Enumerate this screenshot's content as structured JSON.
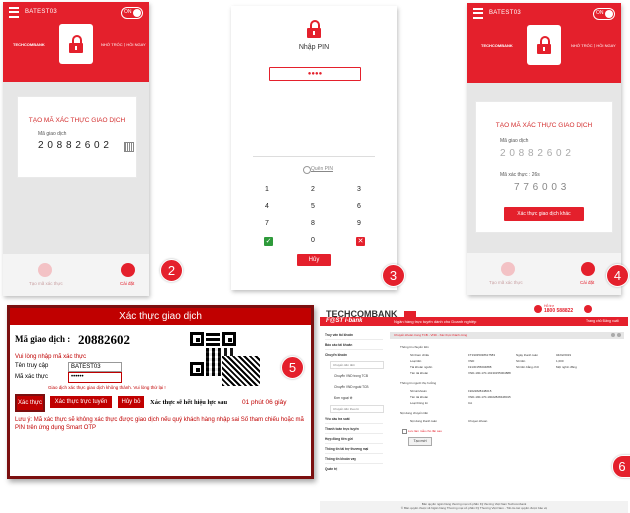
{
  "colors": {
    "brand_red": "#e4202c",
    "dark_red": "#c00000",
    "maroon": "#7b0f0f",
    "green": "#2e9a3a",
    "grey_text": "#9a9a9a"
  },
  "phone2": {
    "username": "BATEST03",
    "toggle": "ON",
    "brand": "TECHCOMBANK",
    "tagline": "NHỚ TRÓC ⟩ HỒI NGAY",
    "card_title": "TẠO MÃ XÁC THỰC GIAO DỊCH",
    "code_label": "Mã giao dịch",
    "code": "2 0 8 8 2 6 0 2",
    "nav_left": "Tạo mã xác thực",
    "nav_right": "Cài đặt",
    "badge": "2"
  },
  "phone3": {
    "title": "Nhập PIN",
    "pin_value": "●●●●",
    "forgot": "Quên PIN",
    "keys": [
      "1",
      "2",
      "3",
      "4",
      "5",
      "6",
      "7",
      "8",
      "9",
      "0"
    ],
    "cancel": "Hủy",
    "badge": "3"
  },
  "phone4": {
    "username": "BATEST03",
    "toggle": "ON",
    "brand": "TECHCOMBANK",
    "tagline": "NHỚ TRÓC ⟩ HỒI NGAY",
    "card_title": "TẠO MÃ XÁC THỰC GIAO DỊCH",
    "code_label": "Mã giao dịch",
    "code": "2 0 8 8 2 6 0 2",
    "auth_label": "Mã xác thực : 26s",
    "auth_code": "7 7 6 0 0 3",
    "other_button": "Xác thực giao dịch khác",
    "nav_left": "Tạo mã xác thực",
    "nav_right": "Cài đặt",
    "badge": "4"
  },
  "panel5": {
    "header": "Xác thực giao dịch",
    "code_label": "Mã giao dịch :",
    "code": "20882602",
    "hint": "Vui lòng nhập mã xác thực",
    "user_label": "Tên truy cập",
    "user_value": "BATEST03",
    "auth_label": "Mã xác thực",
    "auth_value": "••••••",
    "error": "Giao dịch xác thực giao dịch không thành. Vui lòng thử lại !",
    "btn_confirm": "Xác thực",
    "btn_online": "Xác thực trực tuyến",
    "btn_cancel": "Hủy bỏ",
    "expire_text": "Xác thực sẽ hết hiệu lực sau",
    "expire_time": "01 phút 06 giây",
    "note": "Lưu ý: Mã xác thực sẽ không xác thực được giao dịch nếu quý khách hàng nhập sai Số tham chiếu hoặc mã PIN trên ứng dụng Smart OTP",
    "badge": "5"
  },
  "panel6": {
    "brand": "TECHCOMBANK",
    "hotline_label": "Hỗ trợ",
    "hotline": "1800 588822",
    "subtitle": "F@ST i-bank",
    "nav_title": "Ngân hàng trực tuyến dành cho Doanh nghiệp",
    "header_right": "Trang chủ  Đăng xuất",
    "sidebar": [
      "Truy vấn tài khoản",
      "Báo cáo tài khoản",
      "Chuyển khoản",
      "Chuyển tiền đơn",
      "Chuyển VND trong TCB",
      "Chuyển VND ngoài TCB",
      "Đơn ngoại tệ",
      "Chuyển tiền theo lô",
      "Yêu cầu tra soát",
      "Thanh toán trực tuyến",
      "Hợp đồng tiền gửi",
      "Thông tin tài trợ thương mại",
      "Thông tin khoản vay",
      "Quản trị"
    ],
    "content_title": "Chuyển khoản trong TCB - VND - Xác thực thành công",
    "section1": "Thông tin chuyển tiền",
    "rows1": [
      [
        "Số tham chiếu",
        "FT19035038617583"
      ],
      [
        "Loại tiền",
        "VND"
      ],
      [
        "Tài khoản nguồn",
        "19130155004888"
      ],
      [
        "Tên tài khoản",
        "VND-190-170-19130155004888"
      ]
    ],
    "rows1_right": [
      [
        "Ngày thanh toán",
        "04/02/2019"
      ],
      [
        "Số tiền",
        "1,000"
      ],
      [
        "Số tiền bằng chữ",
        "Một nghìn đồng"
      ]
    ],
    "section2": "Thông tin người thụ hưởng",
    "rows2": [
      [
        "Số tài khoản",
        "19022828448015"
      ],
      [
        "Tên tài khoản",
        "VND-190-170-19022828448015"
      ],
      [
        "Loại thông tin",
        "CA"
      ]
    ],
    "section3": "Nội dung chuyển tiền",
    "rows3": [
      [
        "Nội dung thanh toán",
        "Chuyen khoan"
      ]
    ],
    "checkbox": "Lưu làm mẫu cho lần sau",
    "button": "Tạo mới",
    "footer1": "Bản quyền ngân hàng thương mại cổ phần Kỹ thương Việt Nam Techcombank",
    "footer2": "© Bản quyền thuộc về Ngân hàng Thương mại cổ phần Kỹ Thương Việt Nam - Tất cả các quyền được bảo vệ",
    "badge": "6"
  }
}
